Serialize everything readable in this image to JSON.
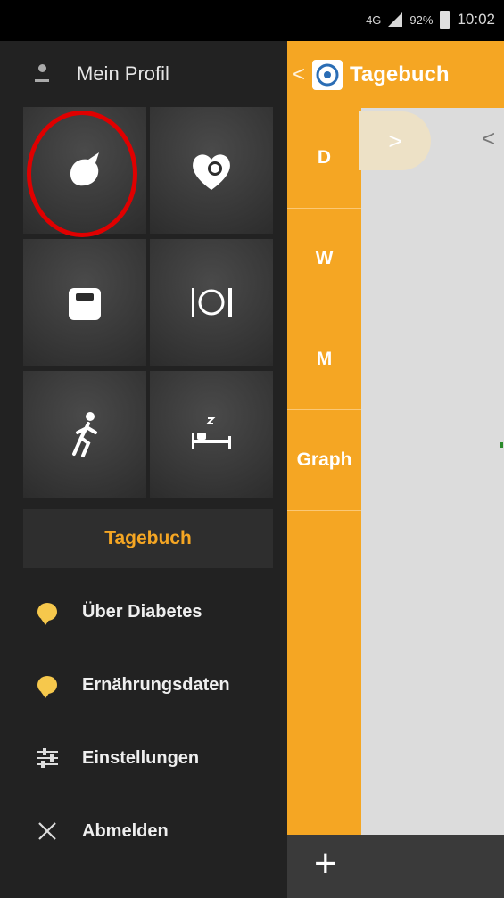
{
  "status_bar": {
    "network": "4G",
    "battery": "92%",
    "time": "10:02"
  },
  "drawer": {
    "profile_label": "Mein Profil",
    "tiles": [
      {
        "name": "blood-drop-icon"
      },
      {
        "name": "heart-pressure-icon"
      },
      {
        "name": "scale-icon"
      },
      {
        "name": "meal-icon"
      },
      {
        "name": "running-icon"
      },
      {
        "name": "sleep-icon"
      }
    ],
    "diary_label": "Tagebuch",
    "menu": [
      {
        "label": "Über Diabetes",
        "icon": "info-bubble-icon"
      },
      {
        "label": "Ernährungsdaten",
        "icon": "info-bubble-icon"
      },
      {
        "label": "Einstellungen",
        "icon": "sliders-icon"
      },
      {
        "label": "Abmelden",
        "icon": "close-icon"
      }
    ]
  },
  "app": {
    "title": "Tagebuch",
    "tabs": [
      "D",
      "W",
      "M",
      "Graph"
    ],
    "next_glyph": ">",
    "prev_glyph": "<",
    "back_glyph": "<",
    "add_glyph": "+"
  },
  "colors": {
    "accent": "#f5a623",
    "drawer_bg": "#222222",
    "highlight_ring": "#e00000"
  }
}
